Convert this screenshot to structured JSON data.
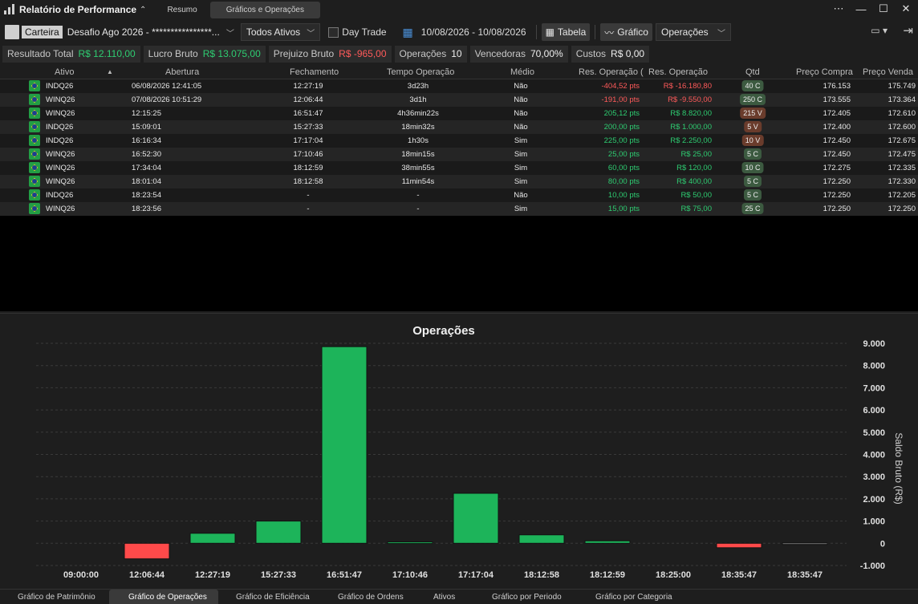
{
  "app": {
    "title": "Relatório de Performance",
    "tabs": [
      "Resumo",
      "Gráficos e Operações"
    ]
  },
  "toolbar": {
    "carteira_label": "Carteira",
    "desafio": "Desafio Ago 2026 - ****************...",
    "ativos": "Todos Ativos",
    "day_trade": "Day Trade",
    "date_range": "10/08/2026 - 10/08/2026",
    "tabela": "Tabela",
    "grafico": "Gráfico",
    "view_select": "Operações"
  },
  "summary": [
    {
      "label": "Resultado Total",
      "value": "R$ 12.110,00",
      "color": "green"
    },
    {
      "label": "Lucro Bruto",
      "value": "R$ 13.075,00",
      "color": "green"
    },
    {
      "label": "Prejuizo Bruto",
      "value": "R$ -965,00",
      "color": "red"
    },
    {
      "label": "Operações",
      "value": "10",
      "color": "white"
    },
    {
      "label": "Vencedoras",
      "value": "70,00%",
      "color": "white"
    },
    {
      "label": "Custos",
      "value": "R$ 0,00",
      "color": "white"
    }
  ],
  "table": {
    "headers": [
      "Ativo",
      "Abertura",
      "Fechamento",
      "Tempo Operação",
      "Médio",
      "Res. Operação (",
      "Res. Operação",
      "Qtd",
      "Preço Compra",
      "Preço Venda"
    ],
    "rows": [
      [
        "INDQ26",
        "06/08/2026 12:41:05",
        "12:27:19",
        "3d23h",
        "Não",
        "-404,52 pts",
        "R$ -16.180,80",
        "40 C",
        "176.153",
        "175.749"
      ],
      [
        "WINQ26",
        "07/08/2026 10:51:29",
        "12:06:44",
        "3d1h",
        "Não",
        "-191,00 pts",
        "R$ -9.550,00",
        "250 C",
        "173.555",
        "173.364"
      ],
      [
        "WINQ26",
        "12:15:25",
        "16:51:47",
        "4h36min22s",
        "Não",
        "205,12 pts",
        "R$ 8.820,00",
        "215 V",
        "172.405",
        "172.610"
      ],
      [
        "INDQ26",
        "15:09:01",
        "15:27:33",
        "18min32s",
        "Não",
        "200,00 pts",
        "R$ 1.000,00",
        "5 V",
        "172.400",
        "172.600"
      ],
      [
        "INDQ26",
        "16:16:34",
        "17:17:04",
        "1h30s",
        "Sim",
        "225,00 pts",
        "R$ 2.250,00",
        "10 V",
        "172.450",
        "172.675"
      ],
      [
        "WINQ26",
        "16:52:30",
        "17:10:46",
        "18min15s",
        "Sim",
        "25,00 pts",
        "R$ 25,00",
        "5 C",
        "172.450",
        "172.475"
      ],
      [
        "WINQ26",
        "17:34:04",
        "18:12:59",
        "38min55s",
        "Sim",
        "60,00 pts",
        "R$ 120,00",
        "10 C",
        "172.275",
        "172.335"
      ],
      [
        "WINQ26",
        "18:01:04",
        "18:12:58",
        "11min54s",
        "Sim",
        "80,00 pts",
        "R$ 400,00",
        "5 C",
        "172.250",
        "172.330"
      ],
      [
        "INDQ26",
        "18:23:54",
        "-",
        "-",
        "Não",
        "10,00 pts",
        "R$ 50,00",
        "5 C",
        "172.250",
        "172.205"
      ],
      [
        "WINQ26",
        "18:23:56",
        "-",
        "-",
        "Sim",
        "15,00 pts",
        "R$ 75,00",
        "25 C",
        "172.250",
        "172.250"
      ]
    ]
  },
  "chart_data": {
    "type": "bar",
    "title": "Operações",
    "ylabel": "Saldo Bruto (R$)",
    "ylim": [
      -1000,
      9000
    ],
    "yticks": [
      "9.000",
      "8.000",
      "7.000",
      "6.000",
      "5.000",
      "4.000",
      "3.000",
      "2.000",
      "1.000",
      "0",
      "-1.000"
    ],
    "categories": [
      "09:00:00",
      "12:06:44",
      "12:27:19",
      "15:27:33",
      "16:51:47",
      "17:10:46",
      "17:17:04",
      "18:12:58",
      "18:12:59",
      "18:25:00",
      "18:35:47",
      "18:35:47"
    ],
    "values": [
      0,
      -700,
      450,
      1000,
      8850,
      60,
      2250,
      380,
      110,
      0,
      -200,
      20
    ],
    "colors": {
      "positive": "#1db45a",
      "negative": "#ff4a4a",
      "neutral": "#777777"
    }
  },
  "bottom_tabs": [
    "Gráfico de Patrimônio",
    "Gráfico de Operações",
    "Gráfico de Eficiência",
    "Gráfico de Ordens",
    "Ativos",
    "Gráfico por Periodo",
    "Gráfico por Categoria"
  ]
}
